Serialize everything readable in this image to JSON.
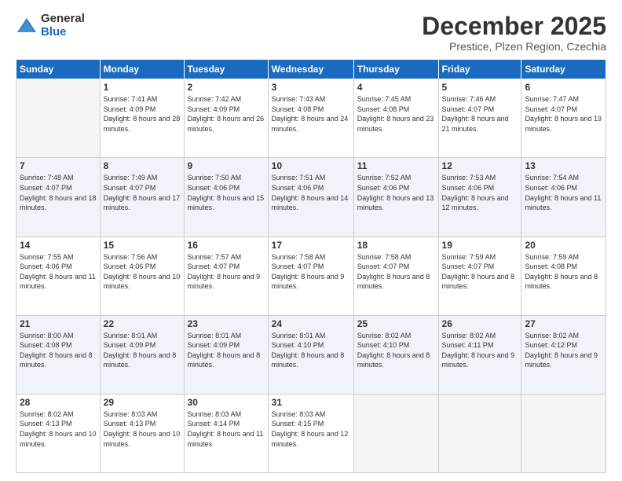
{
  "logo": {
    "general": "General",
    "blue": "Blue"
  },
  "header": {
    "month": "December 2025",
    "location": "Prestice, Plzen Region, Czechia"
  },
  "days_of_week": [
    "Sunday",
    "Monday",
    "Tuesday",
    "Wednesday",
    "Thursday",
    "Friday",
    "Saturday"
  ],
  "weeks": [
    [
      {
        "day": "",
        "empty": true
      },
      {
        "day": "1",
        "sunrise": "7:41 AM",
        "sunset": "4:09 PM",
        "daylight": "8 hours and 28 minutes."
      },
      {
        "day": "2",
        "sunrise": "7:42 AM",
        "sunset": "4:09 PM",
        "daylight": "8 hours and 26 minutes."
      },
      {
        "day": "3",
        "sunrise": "7:43 AM",
        "sunset": "4:08 PM",
        "daylight": "8 hours and 24 minutes."
      },
      {
        "day": "4",
        "sunrise": "7:45 AM",
        "sunset": "4:08 PM",
        "daylight": "8 hours and 23 minutes."
      },
      {
        "day": "5",
        "sunrise": "7:46 AM",
        "sunset": "4:07 PM",
        "daylight": "8 hours and 21 minutes."
      },
      {
        "day": "6",
        "sunrise": "7:47 AM",
        "sunset": "4:07 PM",
        "daylight": "8 hours and 19 minutes."
      }
    ],
    [
      {
        "day": "7",
        "sunrise": "7:48 AM",
        "sunset": "4:07 PM",
        "daylight": "8 hours and 18 minutes."
      },
      {
        "day": "8",
        "sunrise": "7:49 AM",
        "sunset": "4:07 PM",
        "daylight": "8 hours and 17 minutes."
      },
      {
        "day": "9",
        "sunrise": "7:50 AM",
        "sunset": "4:06 PM",
        "daylight": "8 hours and 15 minutes."
      },
      {
        "day": "10",
        "sunrise": "7:51 AM",
        "sunset": "4:06 PM",
        "daylight": "8 hours and 14 minutes."
      },
      {
        "day": "11",
        "sunrise": "7:52 AM",
        "sunset": "4:06 PM",
        "daylight": "8 hours and 13 minutes."
      },
      {
        "day": "12",
        "sunrise": "7:53 AM",
        "sunset": "4:06 PM",
        "daylight": "8 hours and 12 minutes."
      },
      {
        "day": "13",
        "sunrise": "7:54 AM",
        "sunset": "4:06 PM",
        "daylight": "8 hours and 11 minutes."
      }
    ],
    [
      {
        "day": "14",
        "sunrise": "7:55 AM",
        "sunset": "4:06 PM",
        "daylight": "8 hours and 11 minutes."
      },
      {
        "day": "15",
        "sunrise": "7:56 AM",
        "sunset": "4:06 PM",
        "daylight": "8 hours and 10 minutes."
      },
      {
        "day": "16",
        "sunrise": "7:57 AM",
        "sunset": "4:07 PM",
        "daylight": "8 hours and 9 minutes."
      },
      {
        "day": "17",
        "sunrise": "7:58 AM",
        "sunset": "4:07 PM",
        "daylight": "8 hours and 9 minutes."
      },
      {
        "day": "18",
        "sunrise": "7:58 AM",
        "sunset": "4:07 PM",
        "daylight": "8 hours and 8 minutes."
      },
      {
        "day": "19",
        "sunrise": "7:59 AM",
        "sunset": "4:07 PM",
        "daylight": "8 hours and 8 minutes."
      },
      {
        "day": "20",
        "sunrise": "7:59 AM",
        "sunset": "4:08 PM",
        "daylight": "8 hours and 8 minutes."
      }
    ],
    [
      {
        "day": "21",
        "sunrise": "8:00 AM",
        "sunset": "4:08 PM",
        "daylight": "8 hours and 8 minutes."
      },
      {
        "day": "22",
        "sunrise": "8:01 AM",
        "sunset": "4:09 PM",
        "daylight": "8 hours and 8 minutes."
      },
      {
        "day": "23",
        "sunrise": "8:01 AM",
        "sunset": "4:09 PM",
        "daylight": "8 hours and 8 minutes."
      },
      {
        "day": "24",
        "sunrise": "8:01 AM",
        "sunset": "4:10 PM",
        "daylight": "8 hours and 8 minutes."
      },
      {
        "day": "25",
        "sunrise": "8:02 AM",
        "sunset": "4:10 PM",
        "daylight": "8 hours and 8 minutes."
      },
      {
        "day": "26",
        "sunrise": "8:02 AM",
        "sunset": "4:11 PM",
        "daylight": "8 hours and 9 minutes."
      },
      {
        "day": "27",
        "sunrise": "8:02 AM",
        "sunset": "4:12 PM",
        "daylight": "8 hours and 9 minutes."
      }
    ],
    [
      {
        "day": "28",
        "sunrise": "8:02 AM",
        "sunset": "4:13 PM",
        "daylight": "8 hours and 10 minutes."
      },
      {
        "day": "29",
        "sunrise": "8:03 AM",
        "sunset": "4:13 PM",
        "daylight": "8 hours and 10 minutes."
      },
      {
        "day": "30",
        "sunrise": "8:03 AM",
        "sunset": "4:14 PM",
        "daylight": "8 hours and 11 minutes."
      },
      {
        "day": "31",
        "sunrise": "8:03 AM",
        "sunset": "4:15 PM",
        "daylight": "8 hours and 12 minutes."
      },
      {
        "day": "",
        "empty": true
      },
      {
        "day": "",
        "empty": true
      },
      {
        "day": "",
        "empty": true
      }
    ]
  ],
  "labels": {
    "sunrise": "Sunrise:",
    "sunset": "Sunset:",
    "daylight": "Daylight:"
  }
}
